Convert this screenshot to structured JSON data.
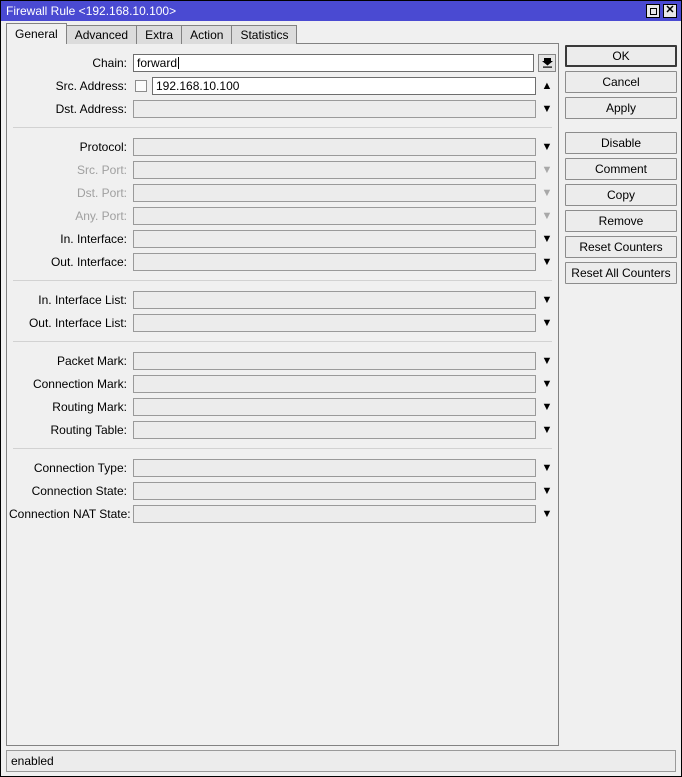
{
  "window": {
    "title": "Firewall Rule <192.168.10.100>",
    "controls": [
      {
        "name": "maximize",
        "glyph": "square"
      },
      {
        "name": "close",
        "glyph": "x"
      }
    ]
  },
  "tabs": [
    {
      "label": "General",
      "active": true
    },
    {
      "label": "Advanced",
      "active": false
    },
    {
      "label": "Extra",
      "active": false
    },
    {
      "label": "Action",
      "active": false
    },
    {
      "label": "Statistics",
      "active": false
    }
  ],
  "form": {
    "groups": [
      {
        "rows": [
          {
            "label": "Chain:",
            "value": "forward",
            "placeholder": "",
            "state": "active",
            "control": "dropdown-button",
            "caret": true,
            "checkbox": false
          },
          {
            "label": "Src. Address:",
            "value": "192.168.10.100",
            "placeholder": "",
            "state": "enabled",
            "control": "arrow-up",
            "caret": false,
            "checkbox": true,
            "checked": false
          },
          {
            "label": "Dst. Address:",
            "value": "",
            "placeholder": "",
            "state": "empty",
            "control": "arrow-down",
            "caret": false,
            "checkbox": false
          }
        ]
      },
      {
        "rows": [
          {
            "label": "Protocol:",
            "value": "",
            "state": "empty",
            "control": "arrow-down",
            "checkbox": false
          },
          {
            "label": "Src. Port:",
            "value": "",
            "state": "disabled",
            "control": "arrow-down-dim",
            "checkbox": false
          },
          {
            "label": "Dst. Port:",
            "value": "",
            "state": "disabled",
            "control": "arrow-down-dim",
            "checkbox": false
          },
          {
            "label": "Any. Port:",
            "value": "",
            "state": "disabled",
            "control": "arrow-down-dim",
            "checkbox": false
          },
          {
            "label": "In. Interface:",
            "value": "",
            "state": "empty",
            "control": "arrow-down",
            "checkbox": false
          },
          {
            "label": "Out. Interface:",
            "value": "",
            "state": "empty",
            "control": "arrow-down",
            "checkbox": false
          }
        ]
      },
      {
        "rows": [
          {
            "label": "In. Interface List:",
            "value": "",
            "state": "empty",
            "control": "arrow-down",
            "checkbox": false
          },
          {
            "label": "Out. Interface List:",
            "value": "",
            "state": "empty",
            "control": "arrow-down",
            "checkbox": false
          }
        ]
      },
      {
        "rows": [
          {
            "label": "Packet Mark:",
            "value": "",
            "state": "empty",
            "control": "arrow-down",
            "checkbox": false
          },
          {
            "label": "Connection Mark:",
            "value": "",
            "state": "empty",
            "control": "arrow-down",
            "checkbox": false
          },
          {
            "label": "Routing Mark:",
            "value": "",
            "state": "empty",
            "control": "arrow-down",
            "checkbox": false
          },
          {
            "label": "Routing Table:",
            "value": "",
            "state": "empty",
            "control": "arrow-down",
            "checkbox": false
          }
        ]
      },
      {
        "rows": [
          {
            "label": "Connection Type:",
            "value": "",
            "state": "empty",
            "control": "arrow-down",
            "checkbox": false
          },
          {
            "label": "Connection State:",
            "value": "",
            "state": "empty",
            "control": "arrow-down",
            "checkbox": false
          },
          {
            "label": "Connection NAT State:",
            "value": "",
            "state": "empty",
            "control": "arrow-down",
            "checkbox": false
          }
        ]
      }
    ]
  },
  "buttons": [
    {
      "label": "OK",
      "primary": true,
      "gap_after": false
    },
    {
      "label": "Cancel",
      "primary": false,
      "gap_after": false
    },
    {
      "label": "Apply",
      "primary": false,
      "gap_after": true
    },
    {
      "label": "Disable",
      "primary": false,
      "gap_after": false
    },
    {
      "label": "Comment",
      "primary": false,
      "gap_after": false
    },
    {
      "label": "Copy",
      "primary": false,
      "gap_after": false
    },
    {
      "label": "Remove",
      "primary": false,
      "gap_after": false
    },
    {
      "label": "Reset Counters",
      "primary": false,
      "gap_after": false
    },
    {
      "label": "Reset All Counters",
      "primary": false,
      "gap_after": false
    }
  ],
  "statusbar": {
    "text": "enabled"
  },
  "colors": {
    "titlebar": "#4a4ad2",
    "titlebar_text": "#ffffff",
    "window_bg": "#f0f0f0",
    "field_border": "#9a9a9a",
    "field_disabled_bg": "#ececec",
    "field_active_bg": "#ffffff",
    "label_disabled": "#a0a0a0",
    "tab_inactive": "#dcdcdc"
  }
}
